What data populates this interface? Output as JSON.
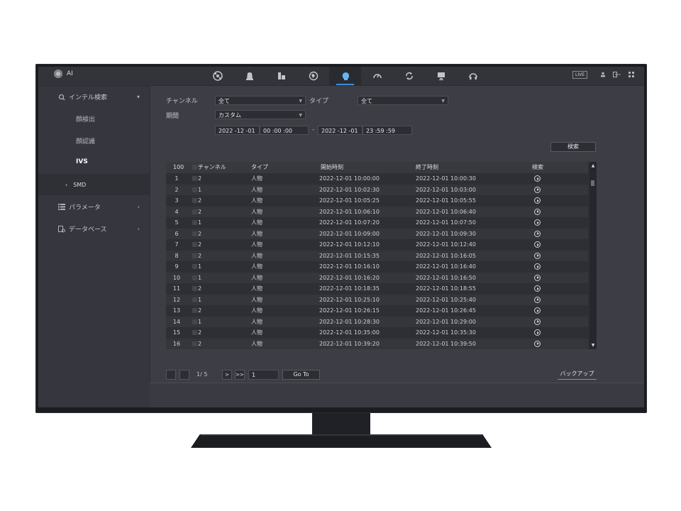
{
  "app": {
    "title": "AI"
  },
  "topbar": {
    "nav_icons": [
      "face-icon",
      "camera-icon",
      "network-icon",
      "globe-icon",
      "ai-icon",
      "speed-icon",
      "sync-icon",
      "monitor-icon",
      "headset-icon"
    ],
    "live_label": "LIVE",
    "user_glyph": "≗"
  },
  "sidebar": {
    "intelli": "インテル検索",
    "face_detect": "顔検出",
    "face_recog": "顔認識",
    "ivs": "IVS",
    "smd": "SMD",
    "params": "パラメータ",
    "database": "データベース"
  },
  "filters": {
    "channel_label": "チャンネル",
    "channel_value": "全て",
    "type_label": "タイプ",
    "type_value": "全て",
    "period_label": "期間",
    "period_value": "カスタム",
    "start_date": "2022 -12 -01",
    "start_time": "00 :00 :00",
    "dash": "-",
    "end_date": "2022 -12 -01",
    "end_time": "23 :59 :59",
    "search_button": "検索"
  },
  "table": {
    "headers": {
      "count": "100",
      "channel": "チャンネル",
      "type": "タイプ",
      "start": "開始時刻",
      "end": "終了時刻",
      "search": "検索"
    },
    "rows": [
      {
        "no": "1",
        "ch": "2",
        "type": "人物",
        "start": "2022-12-01 10:00:00",
        "end": "2022-12-01 10:00:30"
      },
      {
        "no": "2",
        "ch": "1",
        "type": "人物",
        "start": "2022-12-01 10:02:30",
        "end": "2022-12-01 10:03:00"
      },
      {
        "no": "3",
        "ch": "2",
        "type": "人物",
        "start": "2022-12-01 10:05:25",
        "end": "2022-12-01 10:05:55"
      },
      {
        "no": "4",
        "ch": "2",
        "type": "人物",
        "start": "2022-12-01 10:06:10",
        "end": "2022-12-01 10:06:40"
      },
      {
        "no": "5",
        "ch": "1",
        "type": "人物",
        "start": "2022-12-01 10:07:20",
        "end": "2022-12-01 10:07:50"
      },
      {
        "no": "6",
        "ch": "2",
        "type": "人物",
        "start": "2022-12-01 10:09:00",
        "end": "2022-12-01 10:09:30"
      },
      {
        "no": "7",
        "ch": "2",
        "type": "人物",
        "start": "2022-12-01 10:12:10",
        "end": "2022-12-01 10:12:40"
      },
      {
        "no": "8",
        "ch": "2",
        "type": "人物",
        "start": "2022-12-01 10:15:35",
        "end": "2022-12-01 10:16:05"
      },
      {
        "no": "9",
        "ch": "1",
        "type": "人物",
        "start": "2022-12-01 10:16:10",
        "end": "2022-12-01 10:16:40"
      },
      {
        "no": "10",
        "ch": "1",
        "type": "人物",
        "start": "2022-12-01 10:16:20",
        "end": "2022-12-01 10:16:50"
      },
      {
        "no": "11",
        "ch": "2",
        "type": "人物",
        "start": "2022-12-01 10:18:35",
        "end": "2022-12-01 10:18:55"
      },
      {
        "no": "12",
        "ch": "1",
        "type": "人物",
        "start": "2022-12-01 10:25:10",
        "end": "2022-12-01 10:25:40"
      },
      {
        "no": "13",
        "ch": "2",
        "type": "人物",
        "start": "2022-12-01 10:26:15",
        "end": "2022-12-01 10:26:45"
      },
      {
        "no": "14",
        "ch": "1",
        "type": "人物",
        "start": "2022-12-01 10:28:30",
        "end": "2022-12-01 10:29:00"
      },
      {
        "no": "15",
        "ch": "2",
        "type": "人物",
        "start": "2022-12-01 10:35:00",
        "end": "2022-12-01 10:35:30"
      },
      {
        "no": "16",
        "ch": "2",
        "type": "人物",
        "start": "2022-12-01 10:39:20",
        "end": "2022-12-01 10:39:50"
      }
    ]
  },
  "pager": {
    "page_info": "1/  5",
    "next": ">",
    "last": ">>",
    "page_input": "1",
    "goto": "Go To",
    "backup": "バックアップ"
  },
  "colors": {
    "accent": "#3b8fe0",
    "panel": "#3d3e45",
    "bezel": "#1b1c20"
  }
}
